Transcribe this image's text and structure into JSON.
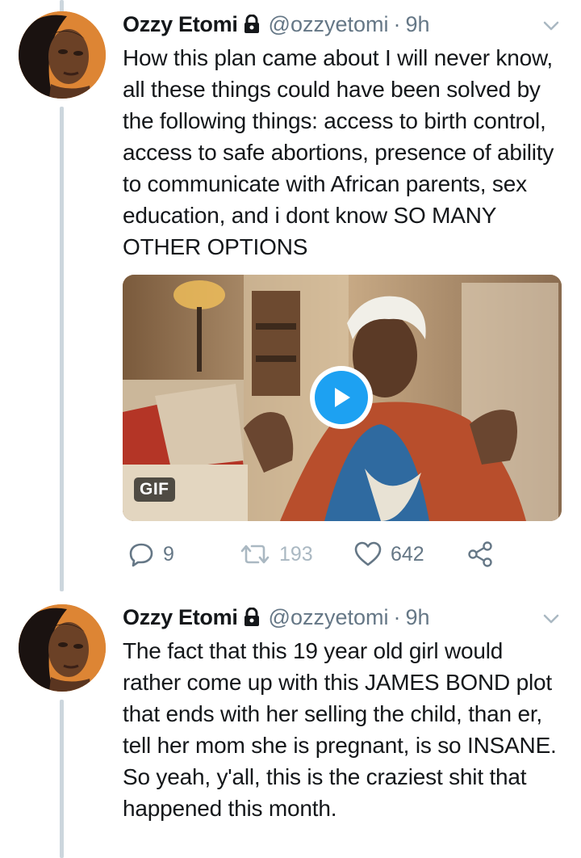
{
  "tweets": [
    {
      "name": "Ozzy Etomi",
      "handle": "@ozzyetomi",
      "separator": "·",
      "time": "9h",
      "text": "How this plan came about I will never know, all these things could have been solved by the following things: access to birth control, access to safe abortions, presence of ability to communicate with African parents, sex education, and i dont know SO MANY OTHER OPTIONS",
      "media": {
        "badge": "GIF",
        "icon": "play-icon"
      },
      "actions": {
        "replies": "9",
        "retweets": "193",
        "likes": "642"
      }
    },
    {
      "name": "Ozzy Etomi",
      "handle": "@ozzyetomi",
      "separator": "·",
      "time": "9h",
      "text": "The fact that this 19 year old girl would rather come up with this JAMES BOND plot that ends with her selling the child, than er, tell her mom she is pregnant, is so INSANE.\nSo yeah, y'all, this is the craziest shit that happened this month."
    }
  ],
  "icons": {
    "lock": "lock-icon",
    "chevron": "chevron-down-icon",
    "reply": "reply-icon",
    "retweet": "retweet-icon",
    "like": "heart-icon",
    "share": "share-icon"
  },
  "colors": {
    "text": "#14171a",
    "secondary": "#657786",
    "accent": "#1da1f2",
    "thread_line": "#ccd6dd"
  }
}
